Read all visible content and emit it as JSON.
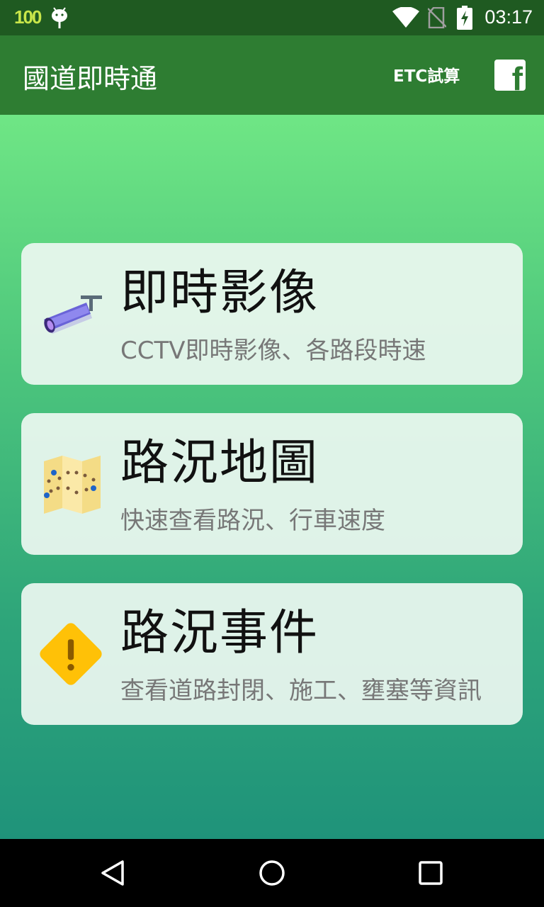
{
  "status_bar": {
    "battery_level": "100",
    "time": "03:17",
    "icons": [
      "android-icon",
      "wifi-icon",
      "no-sim-icon",
      "battery-charging-icon"
    ]
  },
  "app_bar": {
    "title": "國道即時通",
    "etc_label": "ETC試算",
    "facebook_icon": "facebook-icon"
  },
  "cards": [
    {
      "title": "即時影像",
      "subtitle": "CCTV即時影像、各路段時速",
      "icon": "cctv-camera-icon"
    },
    {
      "title": "路況地圖",
      "subtitle": "快速查看路況、行車速度",
      "icon": "map-icon"
    },
    {
      "title": "路況事件",
      "subtitle": "查看道路封閉、施工、壅塞等資訊",
      "icon": "warning-icon"
    }
  ],
  "nav_bar": {
    "icons": [
      "back-icon",
      "home-icon",
      "recents-icon"
    ]
  },
  "colors": {
    "status_bar": "#1f5a21",
    "app_bar": "#2e7d32",
    "gradient_top": "#6fe685",
    "gradient_bottom": "#1f937a",
    "card_bg": "#ecf8f0",
    "warning": "#ffc107"
  }
}
